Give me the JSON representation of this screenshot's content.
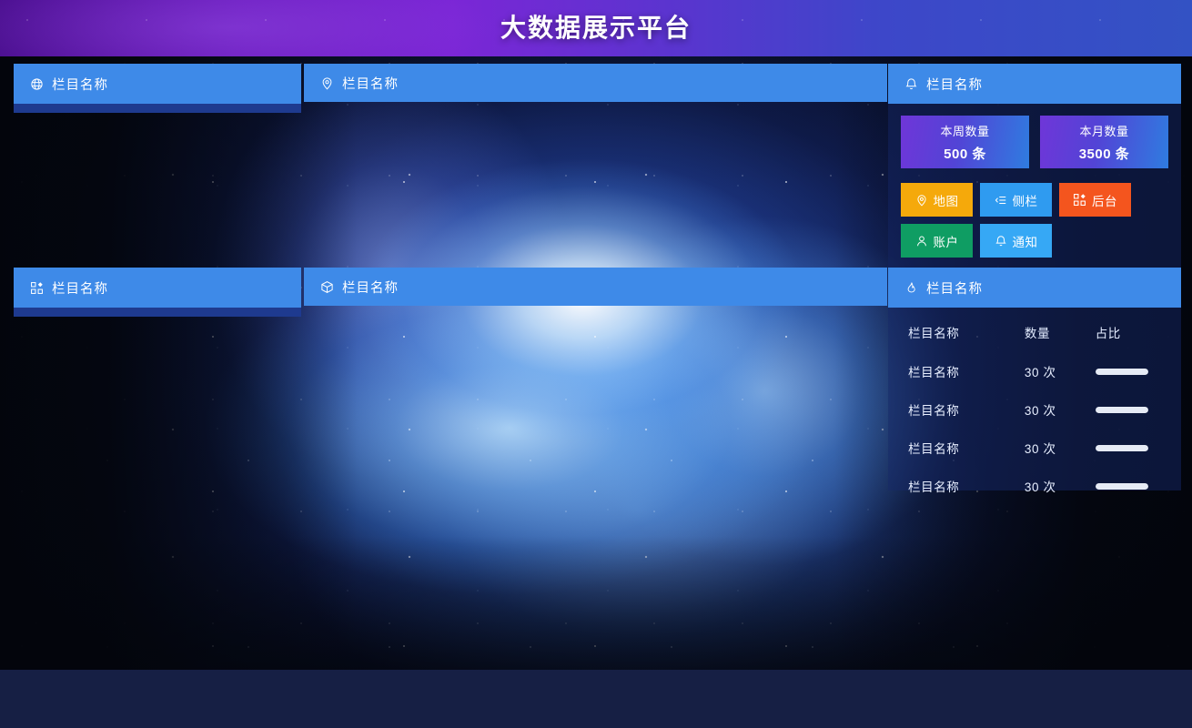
{
  "header": {
    "title": "大数据展示平台"
  },
  "panels": {
    "globe": {
      "title": "栏目名称",
      "icon": "globe-icon"
    },
    "geo": {
      "title": "栏目名称",
      "icon": "map-pin-icon"
    },
    "notify": {
      "title": "栏目名称",
      "icon": "bell-icon"
    },
    "board": {
      "title": "栏目名称",
      "icon": "dashboard-icon"
    },
    "cube": {
      "title": "栏目名称",
      "icon": "cube-icon"
    },
    "rank": {
      "title": "栏目名称",
      "icon": "fire-icon"
    }
  },
  "stats": [
    {
      "label": "本周数量",
      "value": "500 条"
    },
    {
      "label": "本月数量",
      "value": "3500 条"
    }
  ],
  "nav_buttons": [
    {
      "label": "地图",
      "icon": "map-pin-icon",
      "color": "#f5a90b"
    },
    {
      "label": "侧栏",
      "icon": "indent-icon",
      "color": "#2f9bf0"
    },
    {
      "label": "后台",
      "icon": "dashboard-icon",
      "color": "#f4551e"
    },
    {
      "label": "账户",
      "icon": "user-icon",
      "color": "#0f9d63"
    },
    {
      "label": "通知",
      "icon": "bell-icon",
      "color": "#36a8f5"
    }
  ],
  "rank_table": {
    "columns": [
      "栏目名称",
      "数量",
      "占比"
    ],
    "rows": [
      {
        "name": "栏目名称",
        "count": "30 次",
        "pct": 100
      },
      {
        "name": "栏目名称",
        "count": "30 次",
        "pct": 100
      },
      {
        "name": "栏目名称",
        "count": "30 次",
        "pct": 100
      },
      {
        "name": "栏目名称",
        "count": "30 次",
        "pct": 100
      }
    ]
  },
  "theme": {
    "panel_header_blue": "#3e8ae8",
    "panel_underline": "#1e3a8f",
    "header_purple": "#6b1bbf",
    "header_blue": "#3352c4",
    "page_bottom": "#161f44"
  }
}
